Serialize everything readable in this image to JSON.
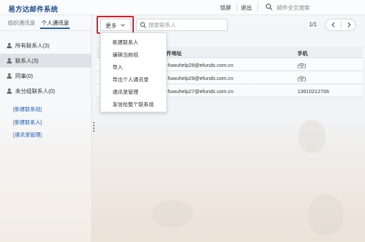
{
  "header": {
    "app_title": "易方达邮件系统",
    "lock_label": "锁屏",
    "logout_label": "退出",
    "search_placeholder": "邮件全文搜索"
  },
  "left_panel": {
    "tabs": [
      {
        "label": "组织通讯录",
        "active": false
      },
      {
        "label": "个人通讯录",
        "active": true
      }
    ],
    "groups": [
      {
        "label": "所有联系人(3)",
        "selected": false
      },
      {
        "label": "联系人(3)",
        "selected": true
      },
      {
        "label": "同事(0)",
        "selected": false
      },
      {
        "label": "未分组联系人(0)",
        "selected": false
      }
    ],
    "links": [
      "[新建联系组]",
      "[新建联系人]",
      "[通讯录管理]"
    ]
  },
  "toolbar": {
    "more_label": "更多",
    "search_placeholder": "搜索联系人",
    "page_indicator": "1/1"
  },
  "table": {
    "columns": [
      "件地址",
      "手机"
    ],
    "rows": [
      {
        "email": "-fuwuhelp28@efunds.com.cn",
        "phone": "(空)"
      },
      {
        "email": "-fuwuhelp29@efunds.com.cn",
        "phone": "(空)"
      },
      {
        "email": "-fuwuhelp27@efunds.com.cn",
        "phone": "13610212706"
      }
    ]
  },
  "more_menu": {
    "items": [
      "新建联系人",
      "编辑当前组",
      "导入",
      "导出个人通讯录",
      "通讯录管理",
      "发信给整个联系组"
    ]
  },
  "colors": {
    "title_blue": "#1f4e8c",
    "link_blue": "#1f5fb0",
    "highlight_red": "#e0141e",
    "selected_row": "#dfe3e8"
  }
}
